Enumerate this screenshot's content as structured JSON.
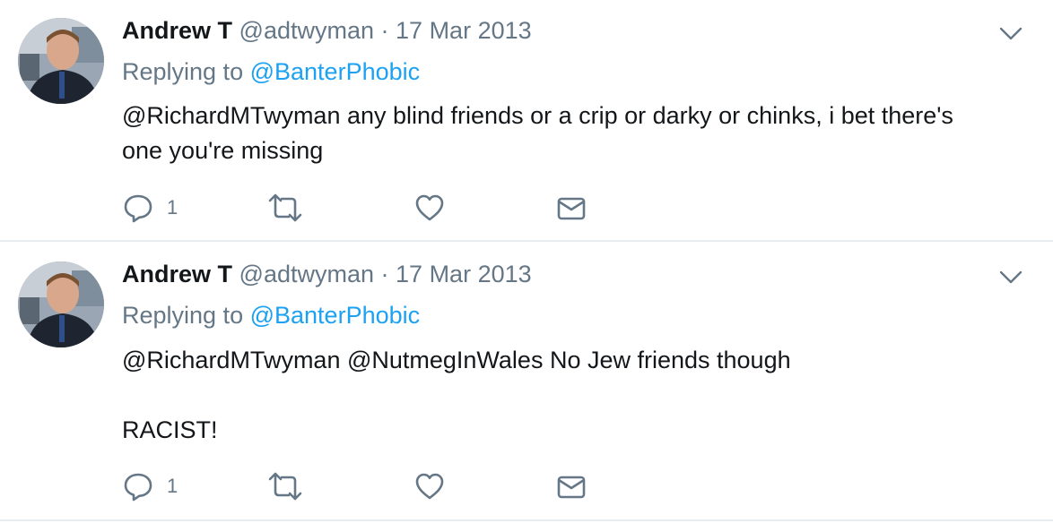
{
  "colors": {
    "text": "#14171a",
    "muted": "#657786",
    "link": "#1da1f2",
    "divider": "#e6ecf0"
  },
  "icons": {
    "reply": "speech-bubble-icon",
    "retweet": "retweet-arrows-icon",
    "like": "heart-icon",
    "dm": "envelope-icon",
    "menu": "chevron-down-icon"
  },
  "tweets": [
    {
      "name": "Andrew T",
      "handle": "@adtwyman",
      "separator": "·",
      "date": "17 Mar 2013",
      "replying_prefix": "Replying to",
      "replying_to": "@BanterPhobic",
      "text": "@RichardMTwyman any blind friends or a crip or darky or chinks, i bet there's\none you're missing",
      "reply_count": "1"
    },
    {
      "name": "Andrew T",
      "handle": "@adtwyman",
      "separator": "·",
      "date": "17 Mar 2013",
      "replying_prefix": "Replying to",
      "replying_to": "@BanterPhobic",
      "text": "@RichardMTwyman @NutmegInWales No Jew friends though\n\nRACIST!",
      "reply_count": "1"
    }
  ]
}
